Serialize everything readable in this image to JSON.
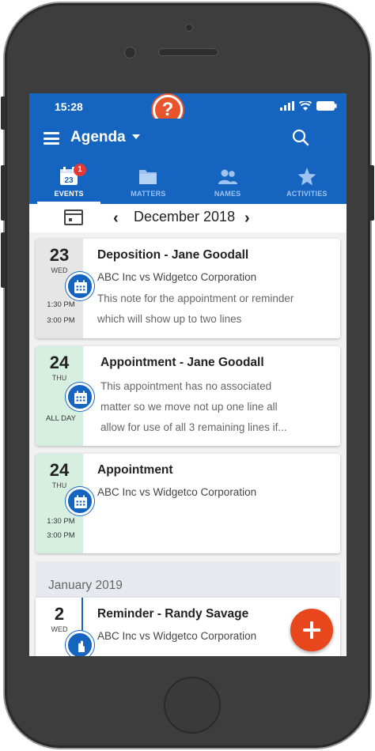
{
  "status_bar": {
    "time": "15:28",
    "help_symbol": "?"
  },
  "app_bar": {
    "title": "Agenda"
  },
  "tabs": [
    {
      "label": "EVENTS",
      "icon": "calendar-icon",
      "icon_text": "23",
      "badge": "1",
      "active": true
    },
    {
      "label": "MATTERS",
      "icon": "folder-icon",
      "active": false
    },
    {
      "label": "NAMES",
      "icon": "people-icon",
      "active": false
    },
    {
      "label": "ACTIVITIES",
      "icon": "star-icon",
      "active": false
    }
  ],
  "date_nav": {
    "month": "December 2018",
    "prev": "‹",
    "next": "›"
  },
  "events": [
    {
      "day": "23",
      "weekday": "WED",
      "title": "Deposition - Jane Goodall",
      "matter": "ABC Inc vs Widgetco Corporation",
      "note_lines": [
        "This note for the appointment or reminder",
        "which will show up to two lines"
      ],
      "start": "1:30 PM",
      "end": "3:00 PM",
      "accent": "#e6e6e6"
    },
    {
      "day": "24",
      "weekday": "THU",
      "title": "Appointment - Jane Goodall",
      "note_lines": [
        "This appointment has no associated",
        "matter so we move not up one line all",
        "allow for use of all 3 remaining lines if..."
      ],
      "allday": "ALL DAY",
      "accent": "#d6efe0"
    },
    {
      "day": "24",
      "weekday": "THU",
      "title": "Appointment",
      "matter": "ABC Inc vs Widgetco Corporation",
      "start": "1:30 PM",
      "end": "3:00 PM",
      "accent": "#d6efe0"
    }
  ],
  "group_header": "January 2019",
  "reminder": {
    "day": "2",
    "weekday": "WED",
    "title": "Reminder - Randy Savage",
    "matter": "ABC Inc vs Widgetco Corporation"
  },
  "colors": {
    "primary": "#1565c0",
    "accent": "#e8471e",
    "allday_green": "#d6efe0"
  }
}
